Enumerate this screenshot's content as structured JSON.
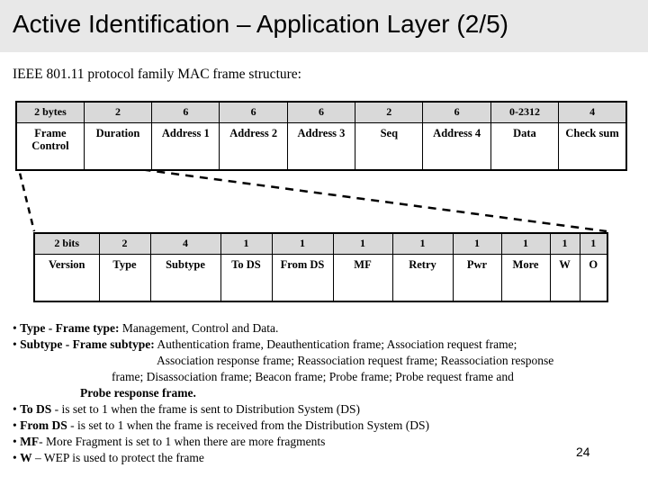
{
  "slide": {
    "title": "Active Identification – Application Layer (2/5)",
    "intro": "IEEE 801.11 protocol family MAC frame structure:",
    "page_number": "24",
    "title_band_color": "#e8e8e8",
    "header_cell_color": "#d9d9d9"
  },
  "mac_frame_table": {
    "name": "IEEE 801.11 MAC frame structure",
    "sizes": [
      "2 bytes",
      "2",
      "6",
      "6",
      "6",
      "2",
      "6",
      "0-2312",
      "4"
    ],
    "fields": [
      "Frame Control",
      "Duration",
      "Address 1",
      "Address 2",
      "Address 3",
      "Seq",
      "Address 4",
      "Data",
      "Check sum"
    ]
  },
  "frame_control_table": {
    "name": "Frame Control field structure",
    "sizes": [
      "2 bits",
      "2",
      "4",
      "1",
      "1",
      "1",
      "1",
      "1",
      "1",
      "1",
      "1"
    ],
    "fields": [
      "Version",
      "Type",
      "Subtype",
      "To DS",
      "From DS",
      "MF",
      "Retry",
      "Pwr",
      "More",
      "W",
      "O"
    ]
  },
  "notes": [
    {
      "bullet": "•",
      "term": "Type - Frame type:",
      "text": " Management, Control and Data.",
      "indent": 0
    },
    {
      "bullet": "•",
      "term": "Subtype - Frame subtype:",
      "text": " Authentication frame, Deauthentication frame; Association request frame;",
      "indent": 0
    },
    {
      "bullet": "",
      "term": "",
      "text": "Association response frame; Reassociation request frame; Reassociation response",
      "indent": 1
    },
    {
      "bullet": "",
      "term": "",
      "text": "frame; Disassociation frame; Beacon frame; Probe frame; Probe request frame and",
      "indent": 2
    },
    {
      "bullet": "",
      "term": "",
      "text": "Probe response frame.",
      "indent": 3
    },
    {
      "bullet": "•",
      "term": "To DS",
      "text": " - is set to 1 when the frame is sent to Distribution System (DS)",
      "indent": 0
    },
    {
      "bullet": "•",
      "term": "From DS",
      "text": " - is set to 1 when the frame is received from the Distribution System (DS)",
      "indent": 0
    },
    {
      "bullet": "•",
      "term": "MF",
      "text": "- More Fragment is set to 1 when there are more fragments",
      "indent": 0
    },
    {
      "bullet": "•",
      "term": "W",
      "text": " – WEP is used to protect the frame",
      "indent": 0
    }
  ]
}
